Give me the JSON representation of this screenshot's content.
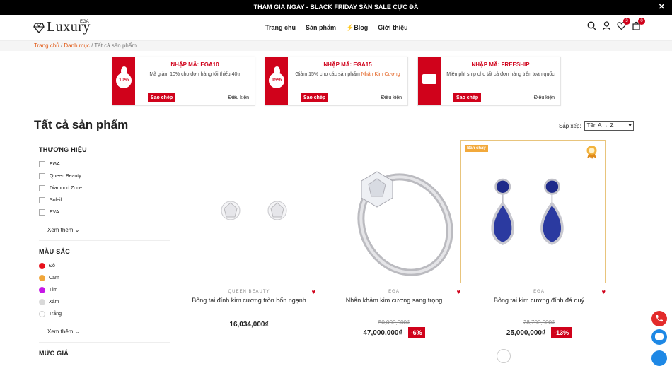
{
  "topbar": {
    "text": "THAM GIA NGAY - BLACK FRIDAY SĂN SALE CỰC ĐÃ",
    "close": "✕"
  },
  "logo": {
    "text": "Luxury",
    "sup": "EGA"
  },
  "nav": [
    {
      "label": "Trang chủ"
    },
    {
      "label": "Sản phẩm"
    },
    {
      "label": "Blog",
      "icon": "bolt-icon"
    },
    {
      "label": "Giới thiệu"
    }
  ],
  "header_icons": {
    "wishlist_count": "3",
    "cart_count": "0"
  },
  "breadcrumb": {
    "home": "Trang chủ",
    "sep1": " / ",
    "category": "Danh mục",
    "sep2": " / ",
    "current": "Tất cả sản phẩm"
  },
  "coupons": [
    {
      "title": "NHẬP MÃ: EGA10",
      "desc": "Mã giảm 10% cho đơn hàng tối thiểu 40tr",
      "badge": "10%",
      "copy": "Sao chép",
      "cond": "Điều kiện"
    },
    {
      "title": "NHẬP MÃ: EGA15",
      "desc_pre": "Giảm 15% cho các sản phẩm ",
      "desc_hl": "Nhẫn Kim Cương",
      "badge": "15%",
      "copy": "Sao chép",
      "cond": "Điều kiện"
    },
    {
      "title": "NHẬP MÃ: FREESHIP",
      "desc": "Miễn phí ship cho tất cả đơn hàng trên toàn quốc",
      "badge": "Freeship",
      "copy": "Sao chép",
      "cond": "Điều kiện"
    }
  ],
  "page_title": "Tất cả sản phẩm",
  "sort": {
    "label": "Sắp xếp:",
    "value": "Tên A → Z"
  },
  "filters": {
    "brand_title": "THƯƠNG HIỆU",
    "brands": [
      "EGA",
      "Queen Beauty",
      "Diamond Zone",
      "Soleil",
      "EVA"
    ],
    "more": "Xem thêm",
    "color_title": "MÀU SẮC",
    "colors": [
      {
        "label": "Đỏ",
        "hex": "#e8101b"
      },
      {
        "label": "Cam",
        "hex": "#f0a63a"
      },
      {
        "label": "Tím",
        "hex": "#c617e6"
      },
      {
        "label": "Xám",
        "hex": "#d9d9d9"
      },
      {
        "label": "Trắng",
        "hex": "#ffffff"
      }
    ],
    "more2": "Xem thêm",
    "price_title": "MỨC GIÁ"
  },
  "products": [
    {
      "vendor": "QUEEN BEAUTY",
      "name": "Bông tai đính kim cương tròn bốn ngạnh",
      "price": "16,034,000₫",
      "old": "",
      "discount": ""
    },
    {
      "vendor": "EGA",
      "name": "Nhẫn khảm kim cương sang trọng",
      "price": "47,000,000₫",
      "old": "50,000,000₫",
      "discount": "-6%"
    },
    {
      "vendor": "EGA",
      "name": "Bông tai kim cương đính đá quý",
      "price": "25,000,000₫",
      "old": "28,700,000₫",
      "discount": "-13%",
      "badge": "Bán chạy"
    }
  ],
  "colors": {
    "accent": "#d0021b",
    "link": "#e25b17"
  }
}
